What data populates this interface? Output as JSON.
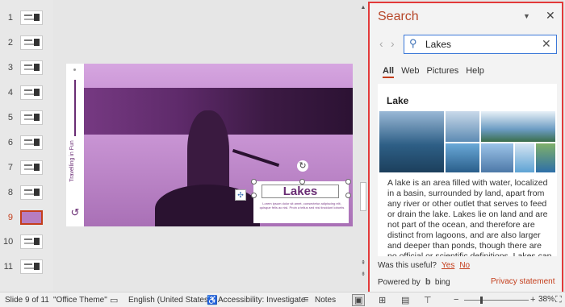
{
  "thumbnails": {
    "numbers": [
      "1",
      "2",
      "3",
      "4",
      "5",
      "6",
      "7",
      "8",
      "9",
      "10",
      "11"
    ],
    "active_index": 9
  },
  "slide": {
    "title": "Lakes",
    "body": "Lorem ipsum dolor sit amet, consectetur adipiscing elit, quisque felis ac nisl. Proin a tellus sed nisi tincidunt lobortis",
    "side_text": "Travelling in Fun"
  },
  "search_pane": {
    "title": "Search",
    "query": "Lakes",
    "tabs": [
      "All",
      "Web",
      "Pictures",
      "Help"
    ],
    "active_tab": "All",
    "result_heading": "Lake",
    "result_text": "A lake is an area filled with water, localized in a basin, surrounded by land, apart from any river or other outlet that serves to feed or drain the lake. Lakes lie on land and are not part of the ocean, and therefore are distinct from lagoons, and are also larger and deeper than ponds, though there are no official or scientific definitions. Lakes can",
    "useful_question": "Was this useful?",
    "useful_yes": "Yes",
    "useful_no": "No",
    "powered_by": "Powered by",
    "bing": "bing",
    "privacy": "Privacy statement",
    "accent_color": "#c43e1c",
    "highlight_border": "#e23a3a"
  },
  "status_bar": {
    "slide_info": "Slide 9 of 11",
    "theme": "\"Office Theme\"",
    "language": "English (United States)",
    "accessibility": "Accessibility: Investigate",
    "notes": "Notes",
    "zoom": "38%",
    "minus": "−",
    "plus": "+"
  },
  "icons": {
    "back": "‹",
    "forward": "›",
    "search": "⚲",
    "clear": "✕",
    "close": "✕",
    "menu": "▼",
    "rotate": "↻",
    "scroll_up": "▲",
    "scroll_down": "▼",
    "logo": "↺"
  }
}
